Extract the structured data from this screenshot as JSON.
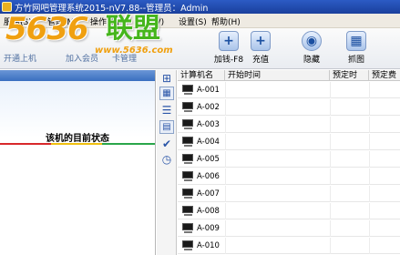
{
  "window": {
    "title": "方竹网吧管理系统2015-nV7.88--管理员：Admin",
    "title_bar_color": "#1f4aa8"
  },
  "menu": [
    {
      "label": "服务(S)"
    },
    {
      "label": "管理(M)"
    },
    {
      "label": "操作(O)"
    },
    {
      "label": "查看(V)"
    },
    {
      "label": "设置(S)"
    },
    {
      "label": "帮助(H)"
    }
  ],
  "watermark": {
    "number": "5636",
    "chinese": "联盟",
    "url": "www.5636.com"
  },
  "toolbar": {
    "left_labels": [
      "开通上机",
      "加入会员",
      "卡管理"
    ],
    "buttons": [
      {
        "label": "加钱-F8",
        "icon": "plus-box-icon"
      },
      {
        "label": "充值",
        "icon": "plus-box-icon"
      },
      {
        "label": "隐藏",
        "icon": "globe-icon"
      },
      {
        "label": "抓图",
        "icon": "calendar-icon"
      }
    ]
  },
  "left_panel": {
    "status_title": "该机的目前状态",
    "accent_colors": [
      "#d8282b",
      "#f0c010",
      "#2aa64a"
    ]
  },
  "sidebar_icons": [
    "tree-view-icon",
    "grid-view-icon",
    "list-view-icon",
    "detail-view-icon",
    "check-icon",
    "clock-icon"
  ],
  "table": {
    "columns": [
      "计算机名",
      "开始时间",
      "预定时",
      "预定费"
    ],
    "rows": [
      {
        "name": "A-001"
      },
      {
        "name": "A-002"
      },
      {
        "name": "A-003"
      },
      {
        "name": "A-004"
      },
      {
        "name": "A-005"
      },
      {
        "name": "A-006"
      },
      {
        "name": "A-007"
      },
      {
        "name": "A-008"
      },
      {
        "name": "A-009"
      },
      {
        "name": "A-010"
      }
    ]
  }
}
